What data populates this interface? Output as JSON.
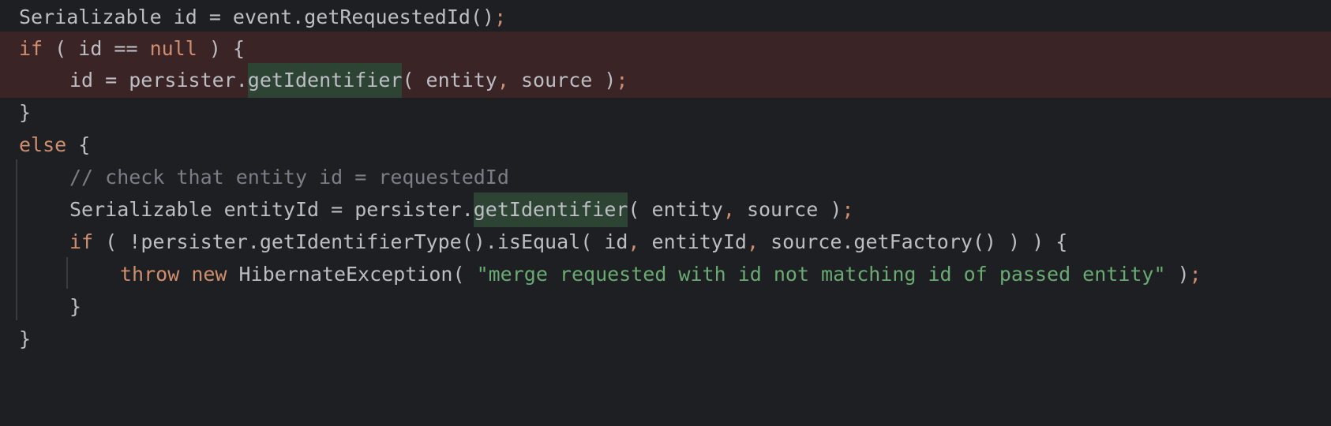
{
  "editor": {
    "lines": [
      {
        "tokens": [
          {
            "t": "Serializable id = event.getRequestedId()",
            "c": "pl"
          },
          {
            "t": ";",
            "c": "kw"
          }
        ]
      },
      {
        "highlight": true,
        "tokens": [
          {
            "t": "if",
            "c": "kw"
          },
          {
            "t": " ( id == ",
            "c": "pl"
          },
          {
            "t": "null",
            "c": "kw"
          },
          {
            "t": " ) {",
            "c": "pl"
          }
        ]
      },
      {
        "highlight": true,
        "tokens": [
          {
            "t": "id = persister.",
            "c": "pl"
          },
          {
            "t": "getIdentifier",
            "c": "pl",
            "occ": true
          },
          {
            "t": "( entity",
            "c": "pl"
          },
          {
            "t": ",",
            "c": "kw"
          },
          {
            "t": " source )",
            "c": "pl"
          },
          {
            "t": ";",
            "c": "kw"
          }
        ]
      },
      {
        "tokens": [
          {
            "t": "}",
            "c": "pl"
          }
        ]
      },
      {
        "tokens": [
          {
            "t": "else",
            "c": "kw"
          },
          {
            "t": " {",
            "c": "pl"
          }
        ]
      },
      {
        "tokens": [
          {
            "t": "// check that entity id = requestedId",
            "c": "cm"
          }
        ]
      },
      {
        "tokens": [
          {
            "t": "Serializable entityId = persister.",
            "c": "pl"
          },
          {
            "t": "getIdentifier",
            "c": "pl",
            "occ": true
          },
          {
            "t": "( entity",
            "c": "pl"
          },
          {
            "t": ",",
            "c": "kw"
          },
          {
            "t": " source )",
            "c": "pl"
          },
          {
            "t": ";",
            "c": "kw"
          }
        ]
      },
      {
        "tokens": [
          {
            "t": "if",
            "c": "kw"
          },
          {
            "t": " ( !persister.getIdentifierType().isEqual( id",
            "c": "pl"
          },
          {
            "t": ",",
            "c": "kw"
          },
          {
            "t": " entityId",
            "c": "pl"
          },
          {
            "t": ",",
            "c": "kw"
          },
          {
            "t": " source.getFactory() ) ) {",
            "c": "pl"
          }
        ]
      },
      {
        "tokens": [
          {
            "t": "throw",
            "c": "kw"
          },
          {
            "t": " ",
            "c": "pl"
          },
          {
            "t": "new",
            "c": "kw"
          },
          {
            "t": " HibernateException( ",
            "c": "pl"
          },
          {
            "t": "\"merge requested with id not matching id of passed entity\"",
            "c": "st"
          },
          {
            "t": " )",
            "c": "pl"
          },
          {
            "t": ";",
            "c": "kw"
          }
        ]
      },
      {
        "tokens": [
          {
            "t": "}",
            "c": "pl"
          }
        ]
      },
      {
        "tokens": [
          {
            "t": "}",
            "c": "pl"
          }
        ]
      }
    ]
  },
  "colors": {
    "background": "#1e1f22",
    "keyword": "#cf8e6d",
    "plain": "#bcbec4",
    "comment": "#7a7e85",
    "string": "#6aab73",
    "line_highlight": "#3b2425",
    "usage_highlight": "#2d4334",
    "indent_guide": "#393b40"
  }
}
